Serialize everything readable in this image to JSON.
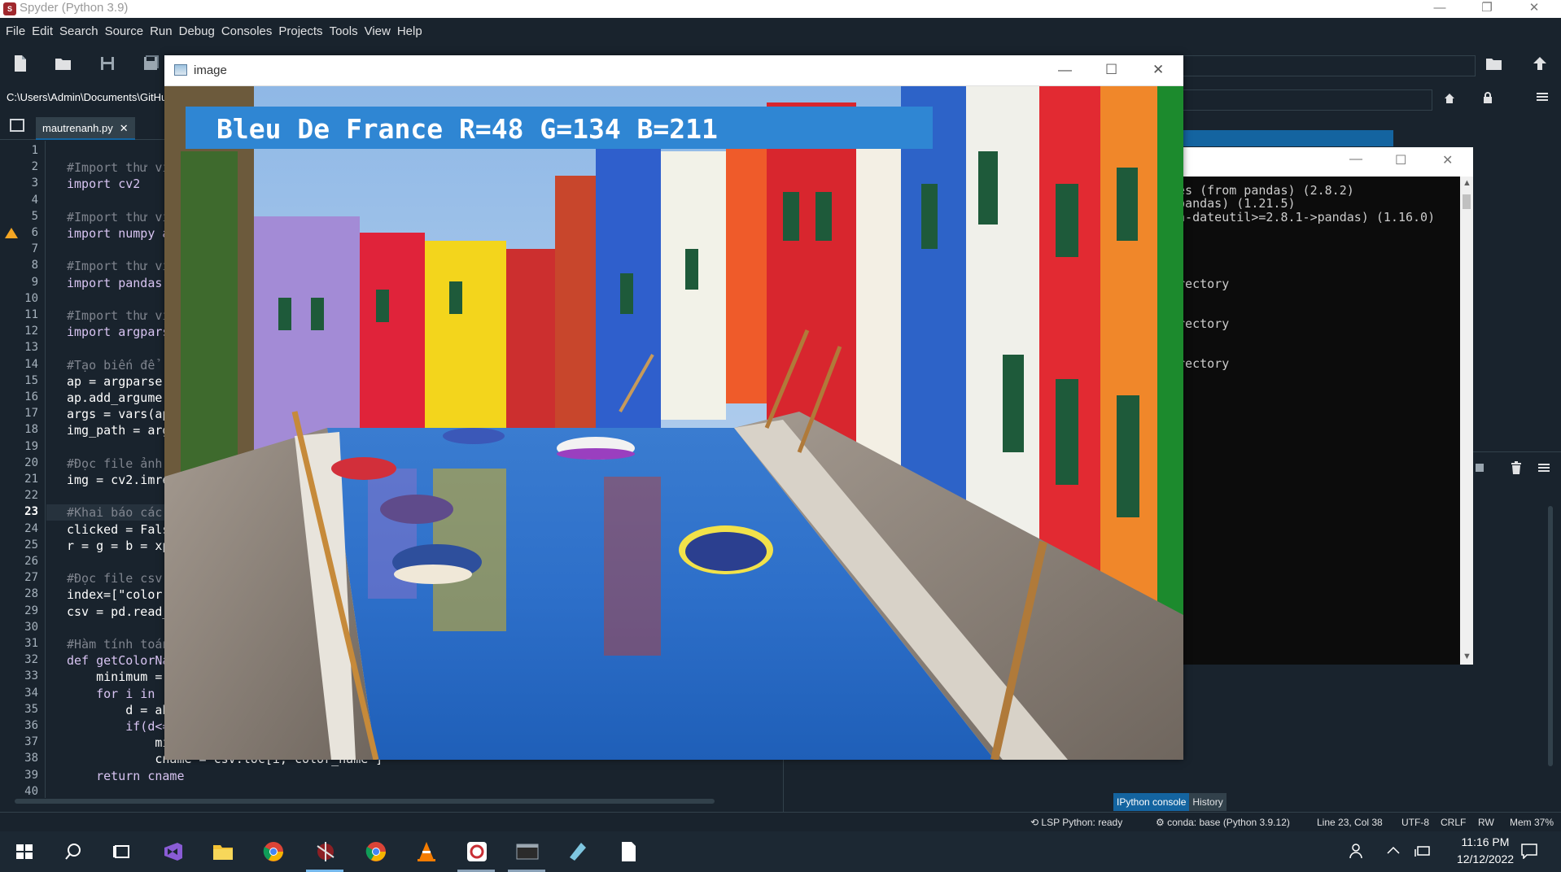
{
  "window": {
    "title": "Spyder (Python 3.9)",
    "logo_text": "S",
    "minimize_glyph": "—",
    "restore_glyph": "❐",
    "close_glyph": "✕"
  },
  "menu": [
    "File",
    "Edit",
    "Search",
    "Source",
    "Run",
    "Debug",
    "Consoles",
    "Projects",
    "Tools",
    "View",
    "Help"
  ],
  "path": "C:\\Users\\Admin\\Documents\\GitHu",
  "editor": {
    "tab_label": "mautrenanh.py",
    "tab_close": "✕",
    "current_line": 23,
    "warning_line": 6,
    "lines": [
      {
        "n": "1",
        "code": ""
      },
      {
        "n": "2",
        "code": "#Import thư vi"
      },
      {
        "n": "3",
        "code": "import cv2"
      },
      {
        "n": "4",
        "code": ""
      },
      {
        "n": "5",
        "code": "#Import thư vi"
      },
      {
        "n": "6",
        "code": "import numpy a"
      },
      {
        "n": "7",
        "code": ""
      },
      {
        "n": "8",
        "code": "#Import thư vi"
      },
      {
        "n": "9",
        "code": "import pandas"
      },
      {
        "n": "10",
        "code": ""
      },
      {
        "n": "11",
        "code": "#Import thư vi"
      },
      {
        "n": "12",
        "code": "import argpars"
      },
      {
        "n": "13",
        "code": ""
      },
      {
        "n": "14",
        "code": "#Tạo biến để"
      },
      {
        "n": "15",
        "code": "ap = argparse"
      },
      {
        "n": "16",
        "code": "ap.add_argumer"
      },
      {
        "n": "17",
        "code": "args = vars(ap"
      },
      {
        "n": "18",
        "code": "img_path = arg"
      },
      {
        "n": "19",
        "code": ""
      },
      {
        "n": "20",
        "code": "#Đọc file ảnh"
      },
      {
        "n": "21",
        "code": "img = cv2.imre"
      },
      {
        "n": "22",
        "code": ""
      },
      {
        "n": "23",
        "code": "#Khai báo các"
      },
      {
        "n": "24",
        "code": "clicked = Fals"
      },
      {
        "n": "25",
        "code": "r = g = b = xp"
      },
      {
        "n": "26",
        "code": ""
      },
      {
        "n": "27",
        "code": "#Đọc file csv"
      },
      {
        "n": "28",
        "code": "index=[\"color"
      },
      {
        "n": "29",
        "code": "csv = pd.read_"
      },
      {
        "n": "30",
        "code": ""
      },
      {
        "n": "31",
        "code": "#Hàm tính toán"
      },
      {
        "n": "32",
        "code": "def getColorNa"
      },
      {
        "n": "33",
        "code": "    minimum ="
      },
      {
        "n": "34",
        "code": "    for i in r"
      },
      {
        "n": "35",
        "code": "        d = ab"
      },
      {
        "n": "36",
        "code": "        if(d<="
      },
      {
        "n": "37",
        "code": "            mi"
      },
      {
        "n": "38",
        "code": "            cname = csv.loc[i, color_name ]"
      },
      {
        "n": "39",
        "code": "    return cname"
      },
      {
        "n": "40",
        "code": ""
      }
    ]
  },
  "terminal": {
    "lines": [
      "ges (from pandas) (2.8.2)",
      " pandas) (1.21.5)",
      "on-dateutil>=2.8.1->pandas) (1.16.0)",
      "",
      "",
      "",
      "",
      "irectory",
      "",
      "",
      "irectory",
      "",
      "",
      "irectory"
    ]
  },
  "image_window": {
    "title": "image",
    "color_label": "Bleu De France R=48 G=134 B=211",
    "label_color": "#2f86d3"
  },
  "bottom_tabs": [
    "IPython console",
    "History"
  ],
  "status": {
    "lsp": "LSP Python: ready",
    "conda": "conda: base (Python 3.9.12)",
    "position": "Line 23, Col 38",
    "encoding": "UTF-8",
    "eol": "CRLF",
    "perm": "RW",
    "mem": "Mem 37%"
  },
  "taskbar": {
    "time": "11:16 PM",
    "date": "12/12/2022",
    "apps": [
      "start-icon",
      "search-icon",
      "task-view-icon",
      "visual-studio-icon",
      "file-explorer-icon",
      "chrome-icon",
      "spyder-icon",
      "chrome-icon",
      "vlc-icon",
      "git-icon",
      "terminal-icon",
      "notes-icon",
      "file-icon"
    ]
  }
}
